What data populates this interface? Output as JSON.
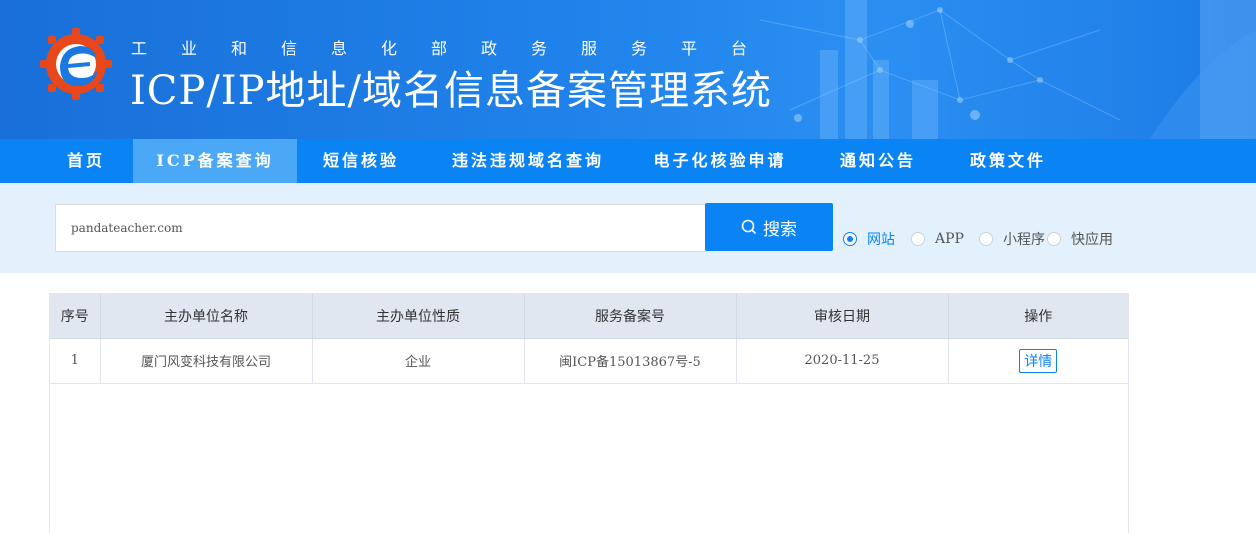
{
  "header": {
    "subtitle": "工业和信息化部政务服务平台",
    "title": "ICP/IP地址/域名信息备案管理系统"
  },
  "nav": {
    "items": [
      {
        "label": "首页",
        "active": false
      },
      {
        "label": "ICP备案查询",
        "active": true
      },
      {
        "label": "短信核验",
        "active": false
      },
      {
        "label": "违法违规域名查询",
        "active": false
      },
      {
        "label": "电子化核验申请",
        "active": false
      },
      {
        "label": "通知公告",
        "active": false
      },
      {
        "label": "政策文件",
        "active": false
      }
    ]
  },
  "search": {
    "value": "pandateacher.com",
    "button_label": "搜索",
    "options": [
      {
        "label": "网站",
        "checked": true
      },
      {
        "label": "APP",
        "checked": false
      },
      {
        "label": "小程序",
        "checked": false
      },
      {
        "label": "快应用",
        "checked": false
      }
    ]
  },
  "table": {
    "headers": [
      "序号",
      "主办单位名称",
      "主办单位性质",
      "服务备案号",
      "审核日期",
      "操作"
    ],
    "rows": [
      {
        "index": "1",
        "org_name": "厦门风变科技有限公司",
        "org_type": "企业",
        "record_no": "闽ICP备15013867号-5",
        "date": "2020-11-25",
        "action": "详情"
      }
    ]
  },
  "colors": {
    "primary": "#0a84f4",
    "nav_active": "#4aa8f7",
    "search_band": "#e3f1fd",
    "header_cell": "#e0e7f0"
  }
}
